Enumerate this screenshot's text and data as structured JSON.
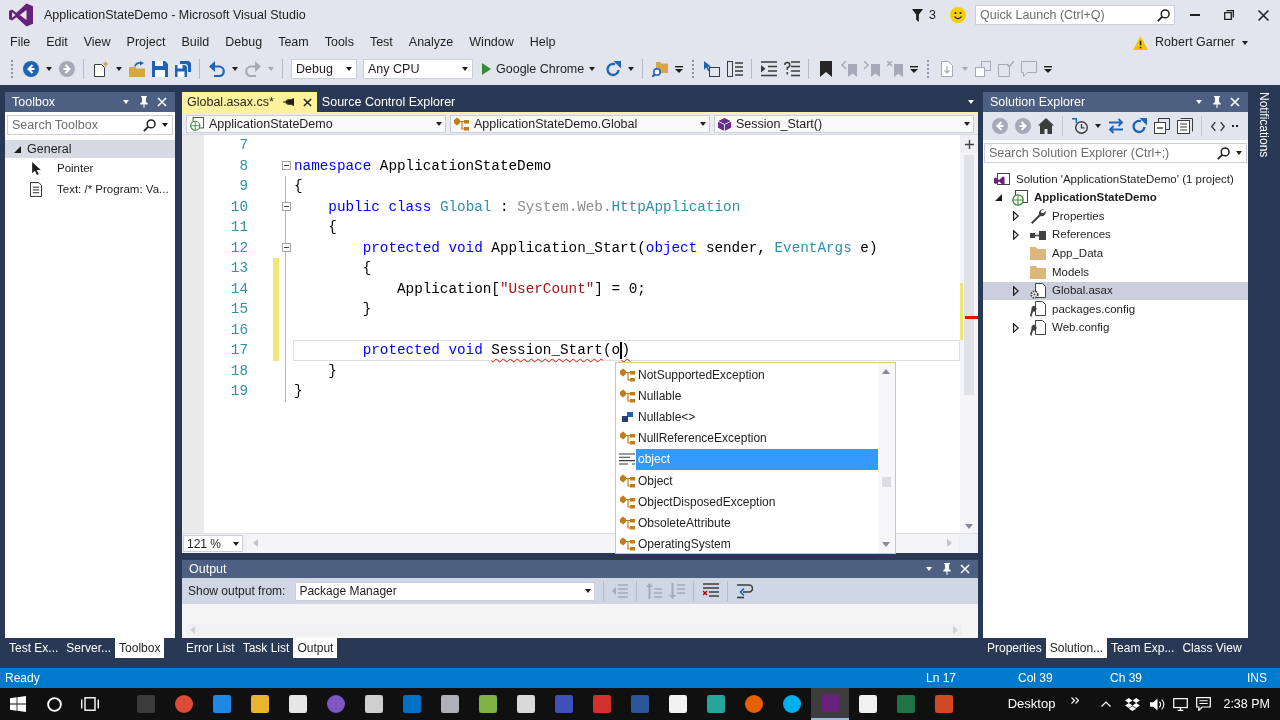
{
  "window": {
    "title": "ApplicationStateDemo - Microsoft Visual Studio",
    "notification_count": "3",
    "quick_launch": {
      "placeholder": "Quick Launch (Ctrl+Q)"
    }
  },
  "menu": {
    "items": [
      "File",
      "Edit",
      "View",
      "Project",
      "Build",
      "Debug",
      "Team",
      "Tools",
      "Test",
      "Analyze",
      "Window",
      "Help"
    ],
    "account": "Robert Garner"
  },
  "toolbars": [
    {
      "groups": [
        [
          {
            "kind": "back",
            "disabled": false
          },
          {
            "kind": "dropdown",
            "disabled": false
          },
          {
            "kind": "forward",
            "disabled": true
          }
        ],
        [
          {
            "kind": "new-project",
            "disabled": false
          },
          {
            "kind": "dropdown",
            "disabled": false
          },
          {
            "kind": "open",
            "disabled": false
          },
          {
            "kind": "save",
            "disabled": false
          },
          {
            "kind": "save-all",
            "disabled": false
          }
        ],
        [
          {
            "kind": "undo",
            "disabled": false
          },
          {
            "kind": "dropdown",
            "disabled": false
          },
          {
            "kind": "redo",
            "disabled": true
          },
          {
            "kind": "dropdown",
            "disabled": true
          }
        ],
        [
          {
            "kind": "combo",
            "value": "Debug",
            "disabled": false
          },
          {
            "kind": "combo",
            "value": "Any CPU",
            "disabled": false
          },
          {
            "kind": "start",
            "label": "Google Chrome",
            "disabled": false
          },
          {
            "kind": "refresh",
            "disabled": false
          },
          {
            "kind": "dropdown",
            "disabled": false
          }
        ],
        [
          {
            "kind": "find",
            "disabled": false
          },
          {
            "kind": "overflow",
            "disabled": false
          }
        ]
      ]
    },
    {
      "groups": [
        [
          {
            "kind": "select-element",
            "disabled": false
          },
          {
            "kind": "list",
            "disabled": false
          }
        ],
        [
          {
            "kind": "indent",
            "disabled": false
          },
          {
            "kind": "comment",
            "disabled": false
          }
        ],
        [
          {
            "kind": "bookmark",
            "disabled": false
          },
          {
            "kind": "bookmark-prev",
            "disabled": true
          },
          {
            "kind": "bookmark-next",
            "disabled": true
          },
          {
            "kind": "bookmark-clear",
            "disabled": true
          },
          {
            "kind": "overflow",
            "disabled": false
          }
        ]
      ]
    },
    {
      "groups": [
        [
          {
            "kind": "page",
            "disabled": true
          },
          {
            "kind": "dropdown",
            "disabled": true
          },
          {
            "kind": "boxes",
            "disabled": true
          },
          {
            "kind": "page-check",
            "disabled": true
          },
          {
            "kind": "chat",
            "disabled": true
          },
          {
            "kind": "overflow",
            "disabled": false
          }
        ]
      ]
    }
  ],
  "toolbox": {
    "title": "Toolbox",
    "search": {
      "placeholder": "Search Toolbox"
    },
    "groups": [
      {
        "label": "General",
        "expanded": true,
        "items": [
          {
            "kind": "pointer",
            "label": "Pointer",
            "selected": false
          },
          {
            "kind": "text",
            "label": "Text: /* Program: Va...",
            "selected": false
          }
        ]
      }
    ],
    "tabs": [
      {
        "label": "Test Ex...",
        "selected": false
      },
      {
        "label": "Server...",
        "selected": false
      },
      {
        "label": "Toolbox",
        "selected": true
      }
    ]
  },
  "editor": {
    "tabs": [
      {
        "label": "Global.asax.cs*",
        "selected": true
      },
      {
        "label": "Source Control Explorer",
        "selected": false
      }
    ],
    "navigation": [
      {
        "kind": "project",
        "value": "ApplicationStateDemo"
      },
      {
        "kind": "class",
        "value": "ApplicationStateDemo.Global"
      },
      {
        "kind": "method",
        "value": "Session_Start()"
      }
    ],
    "lines": [
      {
        "number": "7",
        "changed": false,
        "collapsible": false,
        "current": false
      },
      {
        "number": "8",
        "changed": false,
        "collapsible": true,
        "current": false,
        "tokens": [
          {
            "kind": "keyword",
            "text": "namespace"
          },
          {
            "kind": "plain",
            "text": " ApplicationStateDemo"
          }
        ]
      },
      {
        "number": "9",
        "changed": false,
        "collapsible": false,
        "current": false,
        "tokens": [
          {
            "kind": "plain",
            "text": "{"
          }
        ]
      },
      {
        "number": "10",
        "changed": false,
        "collapsible": true,
        "current": false,
        "tokens": [
          {
            "kind": "keyword",
            "text": "    public class"
          },
          {
            "kind": "type",
            "text": " Global"
          },
          {
            "kind": "plain",
            "text": " :"
          },
          {
            "kind": "faded",
            "text": " System.Web."
          },
          {
            "kind": "type",
            "text": "HttpApplication"
          }
        ]
      },
      {
        "number": "11",
        "changed": false,
        "collapsible": false,
        "current": false,
        "tokens": [
          {
            "kind": "plain",
            "text": "    {"
          }
        ]
      },
      {
        "number": "12",
        "changed": false,
        "collapsible": true,
        "current": false,
        "tokens": [
          {
            "kind": "keyword",
            "text": "        protected void"
          },
          {
            "kind": "plain",
            "text": " Application_Start("
          },
          {
            "kind": "keyword",
            "text": "object"
          },
          {
            "kind": "plain",
            "text": " sender,"
          },
          {
            "kind": "type",
            "text": " EventArgs"
          },
          {
            "kind": "plain",
            "text": " e)"
          }
        ]
      },
      {
        "number": "13",
        "changed": true,
        "collapsible": false,
        "current": false,
        "tokens": [
          {
            "kind": "plain",
            "text": "        {"
          }
        ]
      },
      {
        "number": "14",
        "changed": true,
        "collapsible": false,
        "current": false,
        "tokens": [
          {
            "kind": "plain",
            "text": "            Application["
          },
          {
            "kind": "string",
            "text": "\"UserCount\""
          },
          {
            "kind": "plain",
            "text": "] = 0;"
          }
        ]
      },
      {
        "number": "15",
        "changed": true,
        "collapsible": false,
        "current": false,
        "tokens": [
          {
            "kind": "plain",
            "text": "        }"
          }
        ]
      },
      {
        "number": "16",
        "changed": true,
        "collapsible": false,
        "current": false
      },
      {
        "number": "17",
        "changed": true,
        "collapsible": false,
        "current": true,
        "tokens": [
          {
            "kind": "keyword",
            "text": "        protected void"
          },
          {
            "kind": "error",
            "text": " Session_Start"
          },
          {
            "kind": "plain",
            "text": "(o"
          },
          {
            "kind": "caret"
          },
          {
            "kind": "error",
            "text": ")"
          }
        ]
      },
      {
        "number": "18",
        "changed": false,
        "collapsible": false,
        "current": false,
        "tokens": [
          {
            "kind": "plain",
            "text": "    }"
          }
        ]
      },
      {
        "number": "19",
        "changed": false,
        "collapsible": false,
        "current": false,
        "tokens": [
          {
            "kind": "plain",
            "text": "}"
          }
        ]
      }
    ],
    "zoom": "121 %",
    "completion": [
      {
        "kind": "class",
        "label": "NotSupportedException",
        "selected": false
      },
      {
        "kind": "class",
        "label": "Nullable",
        "selected": false
      },
      {
        "kind": "struct",
        "label": "Nullable<>",
        "selected": false
      },
      {
        "kind": "class",
        "label": "NullReferenceException",
        "selected": false
      },
      {
        "kind": "keyword",
        "label": "object",
        "selected": true
      },
      {
        "kind": "class",
        "label": "Object",
        "selected": false
      },
      {
        "kind": "class",
        "label": "ObjectDisposedException",
        "selected": false
      },
      {
        "kind": "class",
        "label": "ObsoleteAttribute",
        "selected": false
      },
      {
        "kind": "class",
        "label": "OperatingSystem",
        "selected": false
      }
    ]
  },
  "output": {
    "title": "Output",
    "source_label": "Show output from:",
    "source": "Package Manager",
    "groups": [
      [
        {
          "kind": "prev-message",
          "disabled": true
        }
      ],
      [
        {
          "kind": "up",
          "disabled": true
        },
        {
          "kind": "down",
          "disabled": true
        }
      ],
      [
        {
          "kind": "clear",
          "disabled": false
        }
      ],
      [
        {
          "kind": "wrap",
          "disabled": false
        }
      ]
    ],
    "tabs": [
      {
        "label": "Error List",
        "selected": false
      },
      {
        "label": "Task List",
        "selected": false
      },
      {
        "label": "Output",
        "selected": true
      }
    ]
  },
  "solution_explorer": {
    "title": "Solution Explorer",
    "groups": [
      [
        {
          "kind": "back",
          "disabled": true
        },
        {
          "kind": "forward",
          "disabled": true
        },
        {
          "kind": "home",
          "disabled": false
        }
      ],
      [
        {
          "kind": "history",
          "disabled": false
        },
        {
          "kind": "dropdown",
          "disabled": false
        },
        {
          "kind": "sync",
          "disabled": false
        },
        {
          "kind": "refresh",
          "disabled": false
        },
        {
          "kind": "collapse",
          "disabled": false
        },
        {
          "kind": "show-all",
          "disabled": false
        }
      ],
      [
        {
          "kind": "code",
          "disabled": false
        },
        {
          "kind": "more",
          "disabled": false
        }
      ]
    ],
    "search": {
      "placeholder": "Search Solution Explorer (Ctrl+;)"
    },
    "tree": [
      {
        "kind": "solution",
        "label": "Solution 'ApplicationStateDemo' (1 project)",
        "expandable": false,
        "selected": false,
        "startup": false,
        "children": [
          {
            "kind": "web-project",
            "label": "ApplicationStateDemo",
            "expandable": true,
            "expanded": true,
            "selected": false,
            "startup": true,
            "children": [
              {
                "kind": "properties",
                "label": "Properties",
                "expandable": true,
                "expanded": false,
                "selected": false,
                "startup": false
              },
              {
                "kind": "references",
                "label": "References",
                "expandable": true,
                "expanded": false,
                "selected": false,
                "startup": false
              },
              {
                "kind": "folder",
                "label": "App_Data",
                "expandable": false,
                "selected": false,
                "startup": false
              },
              {
                "kind": "folder",
                "label": "Models",
                "expandable": false,
                "selected": false,
                "startup": false
              },
              {
                "kind": "global",
                "label": "Global.asax",
                "expandable": true,
                "expanded": false,
                "selected": true,
                "startup": false
              },
              {
                "kind": "config",
                "label": "packages.config",
                "expandable": false,
                "selected": false,
                "startup": false
              },
              {
                "kind": "config",
                "label": "Web.config",
                "expandable": true,
                "expanded": false,
                "selected": false,
                "startup": false
              }
            ]
          }
        ]
      }
    ],
    "tabs": [
      {
        "label": "Properties",
        "selected": false
      },
      {
        "label": "Solution...",
        "selected": true
      },
      {
        "label": "Team Exp...",
        "selected": false
      },
      {
        "label": "Class View",
        "selected": false
      }
    ]
  },
  "notifications": "Notifications",
  "status_bar": {
    "message": "Ready",
    "line": "Ln 17",
    "column": "Col 39",
    "character": "Ch 39",
    "mode": "INS"
  },
  "taskbar": {
    "apps": [
      {
        "kind": "tile",
        "color": "#3b3b3b",
        "active": false
      },
      {
        "kind": "round",
        "color": "#dd4b39",
        "active": false
      },
      {
        "kind": "tile",
        "color": "#1e88e5",
        "active": false
      },
      {
        "kind": "tile",
        "color": "#e8b530",
        "active": false
      },
      {
        "kind": "tile",
        "color": "#e6e6e6",
        "active": false
      },
      {
        "kind": "round",
        "color": "#7e57c2",
        "active": false
      },
      {
        "kind": "tile",
        "color": "#cfcfcf",
        "active": false
      },
      {
        "kind": "tile",
        "color": "#0072c6",
        "active": false
      },
      {
        "kind": "tile",
        "color": "#b0b0b8",
        "active": false
      },
      {
        "kind": "tile",
        "color": "#7cb342",
        "active": false
      },
      {
        "kind": "tile",
        "color": "#d9d9d9",
        "active": false
      },
      {
        "kind": "tile",
        "color": "#3f51b5",
        "active": false
      },
      {
        "kind": "tile",
        "color": "#d32f2f",
        "active": false
      },
      {
        "kind": "tile",
        "color": "#2b579a",
        "active": false
      },
      {
        "kind": "tile",
        "color": "#f2f2f2",
        "active": false
      },
      {
        "kind": "tile",
        "color": "#26a69a",
        "active": false
      },
      {
        "kind": "round",
        "color": "#e66000",
        "active": false
      },
      {
        "kind": "round",
        "color": "#00aff0",
        "active": false
      },
      {
        "kind": "tile",
        "color": "#68217a",
        "active": true
      },
      {
        "kind": "tile",
        "color": "#f0f0f0",
        "active": false
      },
      {
        "kind": "tile",
        "color": "#217346",
        "active": false
      },
      {
        "kind": "tile",
        "color": "#d24726",
        "active": false
      }
    ],
    "desktop": "Desktop",
    "time": "2:38 PM"
  }
}
